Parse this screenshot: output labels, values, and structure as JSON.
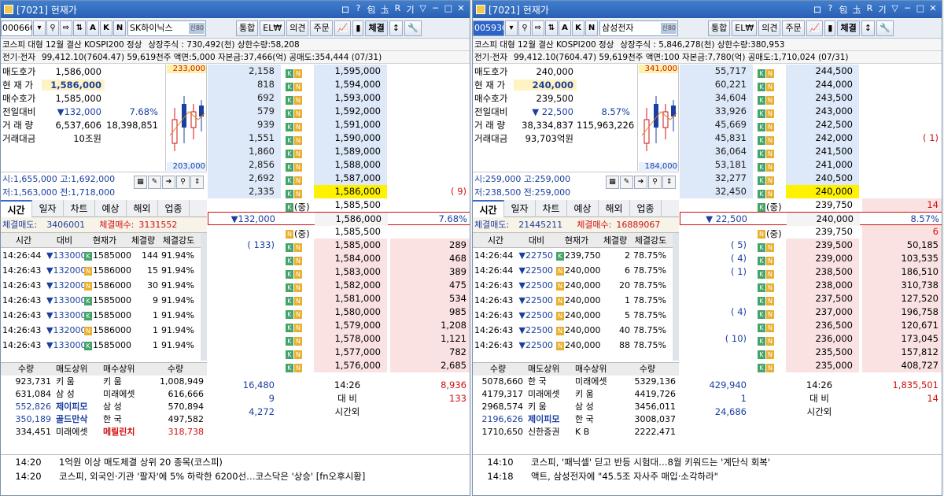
{
  "windows": [
    {
      "title": "[7021] 현재가",
      "title_controls": [
        "ロ",
        "?",
        "包",
        "圡",
        "R",
        "기",
        "▽",
        "─",
        "□",
        "✕"
      ],
      "code": "000660",
      "code_selected": false,
      "name": "SK하이닉스",
      "name_badge": "신80",
      "buttons": [
        "통합",
        "EL₩",
        "의견",
        "주문",
        "체결"
      ],
      "tool_letters": [
        "A",
        "K",
        "N"
      ],
      "info1": [
        "코스피 대형 12월 결산 KOSPI200 정상",
        "상장주식 : 730,492(천) 상한수량:58,208"
      ],
      "info2": [
        "전기·전자",
        "99,412.10(7604.47) 59,619천주 액면:5,000 자본금:37,466(억) 공매도:354,444 (07/31)"
      ],
      "price": {
        "ask_label": "매도호가",
        "ask": "1,586,000",
        "cur_label": "현 재 가",
        "cur": "1,586,000",
        "bid_label": "매수호가",
        "bid": "1,585,000",
        "chg_label": "전일대비",
        "chg": "▼132,000",
        "chg_pct": "7.68%",
        "vol_label": "거 래 량",
        "vol": "6,537,606",
        "vol2": "18,398,851",
        "amt_label": "거래대금",
        "amt": "10조원"
      },
      "mini": {
        "hi": "233,000",
        "lo": "203,000"
      },
      "hl": {
        "row1": "시:1,655,000  고:1,692,000",
        "row2": "저:1,563,000  전:1,718,000"
      },
      "tabs": [
        "시간",
        "일자",
        "차트",
        "예상",
        "해외",
        "업종"
      ],
      "trade_sell_label": "체결매도:",
      "trade_sell": "3406001",
      "trade_buy_label": "체결매수:",
      "trade_buy": "3131552",
      "table_head": [
        "시간",
        "대비",
        "현재가",
        "체결량",
        "체결강도"
      ],
      "trades": [
        {
          "t": "14:26:44",
          "d": "▼133000",
          "b": "K",
          "p": "1585000",
          "q": "144",
          "s": "91.94%"
        },
        {
          "t": "14:26:43",
          "d": "▼132000",
          "b": "N",
          "p": "1586000",
          "q": "15",
          "s": "91.94%"
        },
        {
          "t": "14:26:43",
          "d": "▼132000",
          "b": "N",
          "p": "1586000",
          "q": "30",
          "s": "91.94%"
        },
        {
          "t": "14:26:43",
          "d": "▼133000",
          "b": "K",
          "p": "1585000",
          "q": "9",
          "s": "91.94%"
        },
        {
          "t": "14:26:43",
          "d": "▼133000",
          "b": "K",
          "p": "1585000",
          "q": "1",
          "s": "91.94%"
        },
        {
          "t": "14:26:43",
          "d": "▼132000",
          "b": "N",
          "p": "1586000",
          "q": "1",
          "s": "91.94%"
        },
        {
          "t": "14:26:43",
          "d": "▼133000",
          "b": "K",
          "p": "1585000",
          "q": "1",
          "s": "91.94%"
        }
      ],
      "broker_head": [
        "수량",
        "매도상위",
        "매수상위",
        "수량"
      ],
      "brokers": [
        {
          "sq": "923,731",
          "sn": "키    움",
          "bn": "키    움",
          "bq": "1,008,949",
          "shl": false,
          "bhl": false
        },
        {
          "sq": "631,084",
          "sn": "삼    성",
          "bn": "미래에셋",
          "bq": "616,666",
          "shl": false,
          "bhl": false
        },
        {
          "sq": "552,826",
          "sn": "제이피모",
          "bn": "삼    성",
          "bq": "570,894",
          "shl": true,
          "bhl": false
        },
        {
          "sq": "350,189",
          "sn": "골드만삭",
          "bn": "한    국",
          "bq": "497,582",
          "shl": true,
          "bhl": false
        },
        {
          "sq": "334,451",
          "sn": "미래에셋",
          "bn": "메릴린치",
          "bq": "318,738",
          "shl": false,
          "bhl": true
        }
      ],
      "orderbook": [
        {
          "q": "2,158",
          "badge": "KN",
          "p": "1,595,000",
          "r": "",
          "zone": "ask"
        },
        {
          "q": "818",
          "badge": "KN",
          "p": "1,594,000",
          "r": "",
          "zone": "ask"
        },
        {
          "q": "692",
          "badge": "KN",
          "p": "1,593,000",
          "r": "",
          "zone": "ask"
        },
        {
          "q": "579",
          "badge": "KN",
          "p": "1,592,000",
          "r": "",
          "zone": "ask"
        },
        {
          "q": "939",
          "badge": "KN",
          "p": "1,591,000",
          "r": "",
          "zone": "ask"
        },
        {
          "q": "1,551",
          "badge": "KN",
          "p": "1,590,000",
          "r": "",
          "zone": "ask"
        },
        {
          "q": "1,860",
          "badge": "KN",
          "p": "1,589,000",
          "r": "",
          "zone": "ask"
        },
        {
          "q": "2,856",
          "badge": "KN",
          "p": "1,588,000",
          "r": "",
          "zone": "ask"
        },
        {
          "q": "2,692",
          "badge": "KN",
          "p": "1,587,000",
          "r": "",
          "zone": "ask"
        },
        {
          "q": "2,335",
          "badge": "KN",
          "p": "1,586,000",
          "r": "(        9)",
          "zone": "askcur"
        },
        {
          "q": "",
          "badge": "K(중)",
          "p": "1,585,500",
          "r": "",
          "zone": "mid"
        },
        {
          "q": "▼132,000",
          "badge": "",
          "p": "1,586,000",
          "r": "7.68%",
          "zone": "center"
        },
        {
          "q": "",
          "badge": "N(중)",
          "p": "1,585,500",
          "r": "",
          "zone": "mid"
        },
        {
          "q": "(      133)",
          "badge": "KN",
          "p": "1,585,000",
          "r": "289",
          "zone": "bid"
        },
        {
          "q": "",
          "badge": "KN",
          "p": "1,584,000",
          "r": "468",
          "zone": "bid"
        },
        {
          "q": "",
          "badge": "KN",
          "p": "1,583,000",
          "r": "389",
          "zone": "bid"
        },
        {
          "q": "",
          "badge": "KN",
          "p": "1,582,000",
          "r": "475",
          "zone": "bid"
        },
        {
          "q": "",
          "badge": "KN",
          "p": "1,581,000",
          "r": "534",
          "zone": "bid"
        },
        {
          "q": "",
          "badge": "KN",
          "p": "1,580,000",
          "r": "985",
          "zone": "bid"
        },
        {
          "q": "",
          "badge": "KN",
          "p": "1,579,000",
          "r": "1,208",
          "zone": "bid"
        },
        {
          "q": "",
          "badge": "KN",
          "p": "1,578,000",
          "r": "1,121",
          "zone": "bid"
        },
        {
          "q": "",
          "badge": "KN",
          "p": "1,577,000",
          "r": "782",
          "zone": "bid"
        },
        {
          "q": "",
          "badge": "KN",
          "p": "1,576,000",
          "r": "2,685",
          "zone": "bid"
        },
        {
          "q": "16,480",
          "badge": "",
          "p": "14:26",
          "r": "8,936",
          "zone": "foot"
        },
        {
          "q": "9",
          "badge": "",
          "p": "대    비",
          "r": "133",
          "zone": "foot"
        },
        {
          "q": "4,272",
          "badge": "",
          "p": "시간외",
          "r": "",
          "zone": "foot"
        }
      ],
      "news": [
        {
          "t": "14:20",
          "x": "1억원 이상 매도체결 상위 20 종목(코스피)"
        },
        {
          "t": "14:20",
          "x": "코스피, 외국인·기관 '팔자'에 5% 하락한 6200선…코스닥은 '상승' [fn오후시황]"
        }
      ]
    },
    {
      "title": "[7021] 현재가",
      "title_controls": [
        "ロ",
        "?",
        "包",
        "圡",
        "R",
        "기",
        "▽",
        "─",
        "□",
        "✕"
      ],
      "code": "005930",
      "code_selected": true,
      "name": "삼성전자",
      "name_badge": "신80",
      "buttons": [
        "통합",
        "EL₩",
        "의견",
        "주문",
        "체결"
      ],
      "tool_letters": [
        "A",
        "K",
        "N"
      ],
      "info1": [
        "코스피 대형 12월 결산 KOSPI200 정상",
        "상장주식 : 5,846,278(천) 상한수량:380,953"
      ],
      "info2": [
        "전기·전자",
        "99,412.10(7604.47) 59,619천주 액면:100 자본금:7,780(억) 공매도:1,710,024 (07/31)"
      ],
      "price": {
        "ask_label": "매도호가",
        "ask": "240,000",
        "cur_label": "현 재 가",
        "cur": "240,000",
        "bid_label": "매수호가",
        "bid": "239,500",
        "chg_label": "전일대비",
        "chg": "▼ 22,500",
        "chg_pct": "8.57%",
        "vol_label": "거 래 량",
        "vol": "38,334,837",
        "vol2": "115,963,226",
        "amt_label": "거래대금",
        "amt": "93,703억원"
      },
      "mini": {
        "hi": "341,000",
        "lo": "184,000"
      },
      "hl": {
        "row1": "시:259,000  고:259,000",
        "row2": "저:238,500  전:259,000"
      },
      "tabs": [
        "시간",
        "일자",
        "차트",
        "예상",
        "해외",
        "업종"
      ],
      "trade_sell_label": "체결매도:",
      "trade_sell": "21445211",
      "trade_buy_label": "체결매수:",
      "trade_buy": "16889067",
      "table_head": [
        "시간",
        "대비",
        "현재가",
        "체결량",
        "체결강도"
      ],
      "trades": [
        {
          "t": "14:26:44",
          "d": "▼22750",
          "b": "K",
          "p": "239,750",
          "q": "2",
          "s": "78.75%"
        },
        {
          "t": "14:26:44",
          "d": "▼22500",
          "b": "N",
          "p": "240,000",
          "q": "6",
          "s": "78.75%"
        },
        {
          "t": "14:26:43",
          "d": "▼22500",
          "b": "N",
          "p": "240,000",
          "q": "20",
          "s": "78.75%"
        },
        {
          "t": "14:26:43",
          "d": "▼22500",
          "b": "N",
          "p": "240,000",
          "q": "1",
          "s": "78.75%"
        },
        {
          "t": "14:26:43",
          "d": "▼22500",
          "b": "N",
          "p": "240,000",
          "q": "5",
          "s": "78.75%"
        },
        {
          "t": "14:26:43",
          "d": "▼22500",
          "b": "N",
          "p": "240,000",
          "q": "40",
          "s": "78.75%"
        },
        {
          "t": "14:26:43",
          "d": "▼22500",
          "b": "N",
          "p": "240,000",
          "q": "88",
          "s": "78.75%"
        }
      ],
      "broker_head": [
        "수량",
        "매도상위",
        "매수상위",
        "수량"
      ],
      "brokers": [
        {
          "sq": "5078,660",
          "sn": "한    국",
          "bn": "미래에셋",
          "bq": "5329,136",
          "shl": false,
          "bhl": false
        },
        {
          "sq": "4179,317",
          "sn": "미래에셋",
          "bn": "키    움",
          "bq": "4419,726",
          "shl": false,
          "bhl": false
        },
        {
          "sq": "2968,574",
          "sn": "키    움",
          "bn": "삼    성",
          "bq": "3456,011",
          "shl": false,
          "bhl": false
        },
        {
          "sq": "2196,626",
          "sn": "제이피모",
          "bn": "한    국",
          "bq": "3008,037",
          "shl": true,
          "bhl": false
        },
        {
          "sq": "1710,650",
          "sn": "신한증권",
          "bn": "K       B",
          "bq": "2222,471",
          "shl": false,
          "bhl": false
        }
      ],
      "orderbook": [
        {
          "q": "55,717",
          "badge": "KN",
          "p": "244,500",
          "r": "",
          "zone": "ask"
        },
        {
          "q": "60,221",
          "badge": "KN",
          "p": "244,000",
          "r": "",
          "zone": "ask"
        },
        {
          "q": "34,604",
          "badge": "KN",
          "p": "243,500",
          "r": "",
          "zone": "ask"
        },
        {
          "q": "33,926",
          "badge": "KN",
          "p": "243,000",
          "r": "",
          "zone": "ask"
        },
        {
          "q": "45,669",
          "badge": "KN",
          "p": "242,500",
          "r": "",
          "zone": "ask"
        },
        {
          "q": "45,831",
          "badge": "KN",
          "p": "242,000",
          "r": "(        1)",
          "zone": "ask"
        },
        {
          "q": "36,064",
          "badge": "KN",
          "p": "241,500",
          "r": "",
          "zone": "ask"
        },
        {
          "q": "53,181",
          "badge": "KN",
          "p": "241,000",
          "r": "",
          "zone": "ask"
        },
        {
          "q": "32,277",
          "badge": "KN",
          "p": "240,500",
          "r": "",
          "zone": "ask"
        },
        {
          "q": "32,450",
          "badge": "KN",
          "p": "240,000",
          "r": "",
          "zone": "askcur"
        },
        {
          "q": "",
          "badge": "K(중)",
          "p": "239,750",
          "r": "14",
          "zone": "mid"
        },
        {
          "q": "▼ 22,500",
          "badge": "",
          "p": "240,000",
          "r": "8.57%",
          "zone": "center"
        },
        {
          "q": "",
          "badge": "N(중)",
          "p": "239,750",
          "r": "6",
          "zone": "mid"
        },
        {
          "q": "(        5)",
          "badge": "KN",
          "p": "239,500",
          "r": "50,185",
          "zone": "bid"
        },
        {
          "q": "(        4)",
          "badge": "KN",
          "p": "239,000",
          "r": "103,535",
          "zone": "bid"
        },
        {
          "q": "(        1)",
          "badge": "KN",
          "p": "238,500",
          "r": "186,510",
          "zone": "bid"
        },
        {
          "q": "",
          "badge": "KN",
          "p": "238,000",
          "r": "310,738",
          "zone": "bid"
        },
        {
          "q": "",
          "badge": "KN",
          "p": "237,500",
          "r": "127,520",
          "zone": "bid"
        },
        {
          "q": "(        4)",
          "badge": "KN",
          "p": "237,000",
          "r": "196,758",
          "zone": "bid"
        },
        {
          "q": "",
          "badge": "KN",
          "p": "236,500",
          "r": "120,671",
          "zone": "bid"
        },
        {
          "q": "(       10)",
          "badge": "KN",
          "p": "236,000",
          "r": "173,045",
          "zone": "bid"
        },
        {
          "q": "",
          "badge": "KN",
          "p": "235,500",
          "r": "157,812",
          "zone": "bid"
        },
        {
          "q": "",
          "badge": "KN",
          "p": "235,000",
          "r": "408,727",
          "zone": "bid"
        },
        {
          "q": "429,940",
          "badge": "",
          "p": "14:26",
          "r": "1,835,501",
          "zone": "foot"
        },
        {
          "q": "1",
          "badge": "",
          "p": "대    비",
          "r": "14",
          "zone": "foot"
        },
        {
          "q": "24,686",
          "badge": "",
          "p": "시간외",
          "r": "",
          "zone": "foot"
        }
      ],
      "news": [
        {
          "t": "14:10",
          "x": "코스피, '패닉셀' 딛고 반등 시험대…8월 키워드는 '계단식 회복'"
        },
        {
          "t": "14:18",
          "x": "액트, 삼성전자에 \"45.5조 자사주 매입·소각하라\""
        }
      ]
    }
  ]
}
